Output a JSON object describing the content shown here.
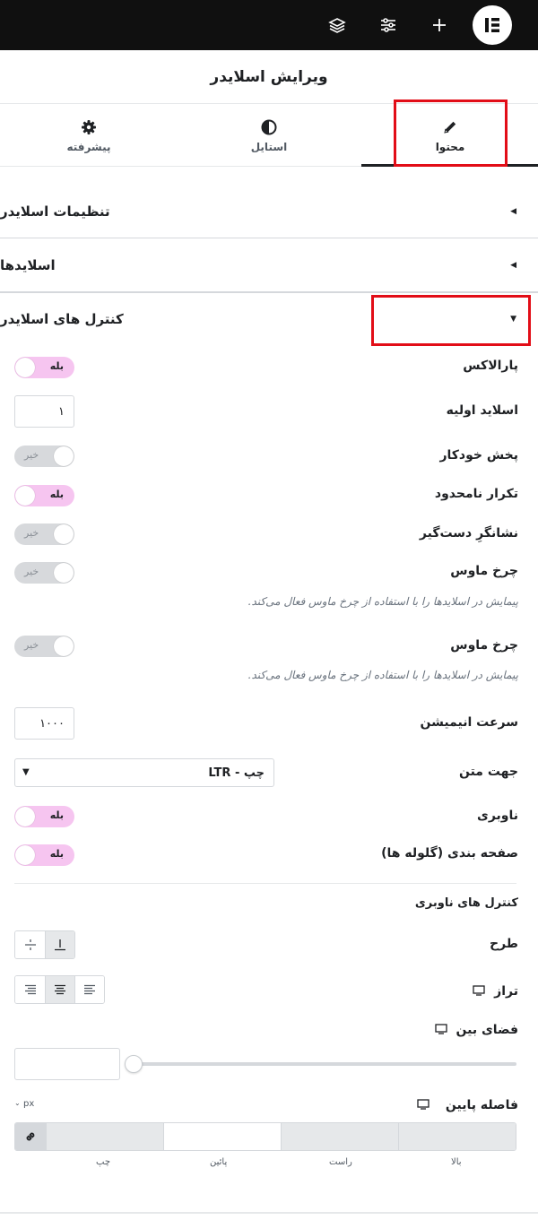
{
  "topbar": {
    "icons": [
      "layers-icon",
      "sliders-icon",
      "plus-icon",
      "elementor-logo"
    ]
  },
  "panel": {
    "title": "ویرایش اسلایدر"
  },
  "tabs": [
    {
      "label": "محتوا",
      "icon": "pencil-icon",
      "active": true
    },
    {
      "label": "استایل",
      "icon": "half-circle-icon",
      "active": false
    },
    {
      "label": "پیشرفته",
      "icon": "gear-icon",
      "active": false
    }
  ],
  "sections": {
    "settings": "تنظیمات اسلایدر",
    "slides": "اسلایدها",
    "controls": "کنترل های اسلایدر"
  },
  "controls": {
    "parallax": {
      "label": "پارالاکس",
      "state": "بله",
      "on": true
    },
    "initial_slide": {
      "label": "اسلاید اولیه",
      "value": "۱"
    },
    "autoplay": {
      "label": "پخش خودکار",
      "state": "خیر",
      "on": false
    },
    "infinite_loop": {
      "label": "تکرار نامحدود",
      "state": "بله",
      "on": true
    },
    "grab_cursor": {
      "label": "نشانگرِ دست‌گیر",
      "state": "خیر",
      "on": false
    },
    "mousewheel1": {
      "label": "چرخ ماوس",
      "state": "خیر",
      "on": false,
      "hint": "پیمایش در اسلایدها را با استفاده از چرخ ماوس فعال می‌کند."
    },
    "mousewheel2": {
      "label": "چرخ ماوس",
      "state": "خیر",
      "on": false,
      "hint": "پیمایش در اسلایدها را با استفاده از چرخ ماوس فعال می‌کند."
    },
    "animation_speed": {
      "label": "سرعت انیمیشن",
      "value": "۱۰۰۰"
    },
    "text_direction": {
      "label": "جهت متن",
      "value": "چپ - LTR"
    },
    "navigation": {
      "label": "ناوبری",
      "state": "بله",
      "on": true
    },
    "pagination": {
      "label": "صفحه بندی (گلوله ها)",
      "state": "بله",
      "on": true
    }
  },
  "nav_controls": {
    "heading": "کنترل های ناوبری",
    "layout_label": "طرح",
    "align_label": "تراز",
    "space_between_label": "فضای بین",
    "bottom_spacing_label": "فاصله پایین",
    "unit": "px",
    "dimension_labels": {
      "top": "بالا",
      "right": "راست",
      "bottom": "پائین",
      "left": "چپ"
    }
  },
  "colors": {
    "accent_on": "#f6c5f0",
    "highlight": "#e20d17",
    "topbar": "#101010"
  }
}
